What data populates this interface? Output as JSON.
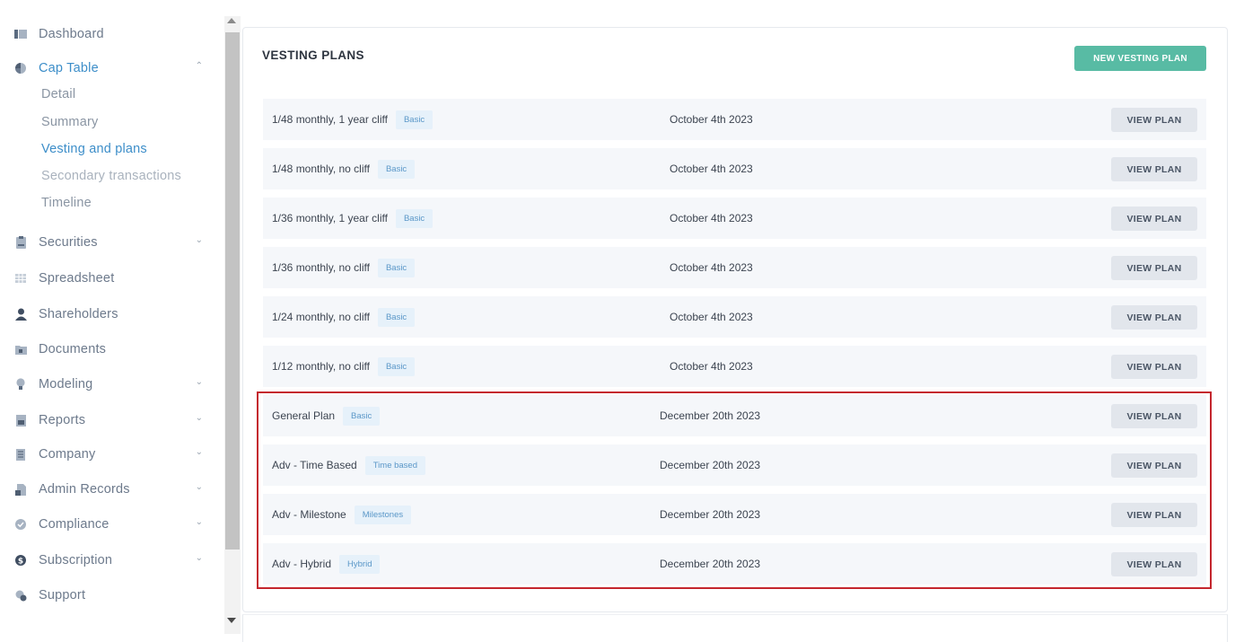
{
  "sidebar": {
    "items": [
      {
        "label": "Dashboard",
        "icon": "dashboard-icon"
      },
      {
        "label": "Cap Table",
        "icon": "pie-chart-icon",
        "expanded": true
      },
      {
        "label": "Securities",
        "icon": "clipboard-icon"
      },
      {
        "label": "Spreadsheet",
        "icon": "grid-icon"
      },
      {
        "label": "Shareholders",
        "icon": "person-icon"
      },
      {
        "label": "Documents",
        "icon": "folder-icon"
      },
      {
        "label": "Modeling",
        "icon": "lightbulb-icon"
      },
      {
        "label": "Reports",
        "icon": "report-icon"
      },
      {
        "label": "Company",
        "icon": "building-icon"
      },
      {
        "label": "Admin Records",
        "icon": "admin-records-icon"
      },
      {
        "label": "Compliance",
        "icon": "shield-icon"
      },
      {
        "label": "Subscription",
        "icon": "dollar-icon"
      },
      {
        "label": "Support",
        "icon": "support-icon"
      }
    ],
    "cap_table_sub": [
      {
        "label": "Detail"
      },
      {
        "label": "Summary"
      },
      {
        "label": "Vesting and plans",
        "active": true
      },
      {
        "label": "Secondary transactions"
      },
      {
        "label": "Timeline"
      }
    ]
  },
  "main": {
    "title": "VESTING PLANS",
    "new_button": "NEW VESTING PLAN",
    "plans": [
      {
        "name": "1/48 monthly, 1 year cliff",
        "tag": "Basic",
        "date": "October 4th 2023",
        "action": "VIEW PLAN"
      },
      {
        "name": "1/48 monthly, no cliff",
        "tag": "Basic",
        "date": "October 4th 2023",
        "action": "VIEW PLAN"
      },
      {
        "name": "1/36 monthly, 1 year cliff",
        "tag": "Basic",
        "date": "October 4th 2023",
        "action": "VIEW PLAN"
      },
      {
        "name": "1/36 monthly, no cliff",
        "tag": "Basic",
        "date": "October 4th 2023",
        "action": "VIEW PLAN"
      },
      {
        "name": "1/24 monthly, no cliff",
        "tag": "Basic",
        "date": "October 4th 2023",
        "action": "VIEW PLAN"
      },
      {
        "name": "1/12 monthly, no cliff",
        "tag": "Basic",
        "date": "October 4th 2023",
        "action": "VIEW PLAN"
      },
      {
        "name": "General Plan",
        "tag": "Basic",
        "date": "December 20th 2023",
        "action": "VIEW PLAN"
      },
      {
        "name": "Adv - Time Based",
        "tag": "Time based",
        "date": "December 20th 2023",
        "action": "VIEW PLAN"
      },
      {
        "name": "Adv - Milestone",
        "tag": "Milestones",
        "date": "December 20th 2023",
        "action": "VIEW PLAN"
      },
      {
        "name": "Adv - Hybrid",
        "tag": "Hybrid",
        "date": "December 20th 2023",
        "action": "VIEW PLAN"
      }
    ]
  },
  "colors": {
    "accent": "#58bba4",
    "active_link": "#3d8ec9",
    "highlight_box": "#c4262e",
    "tag_bg": "#e6f1fa",
    "tag_text": "#5a97c8"
  }
}
